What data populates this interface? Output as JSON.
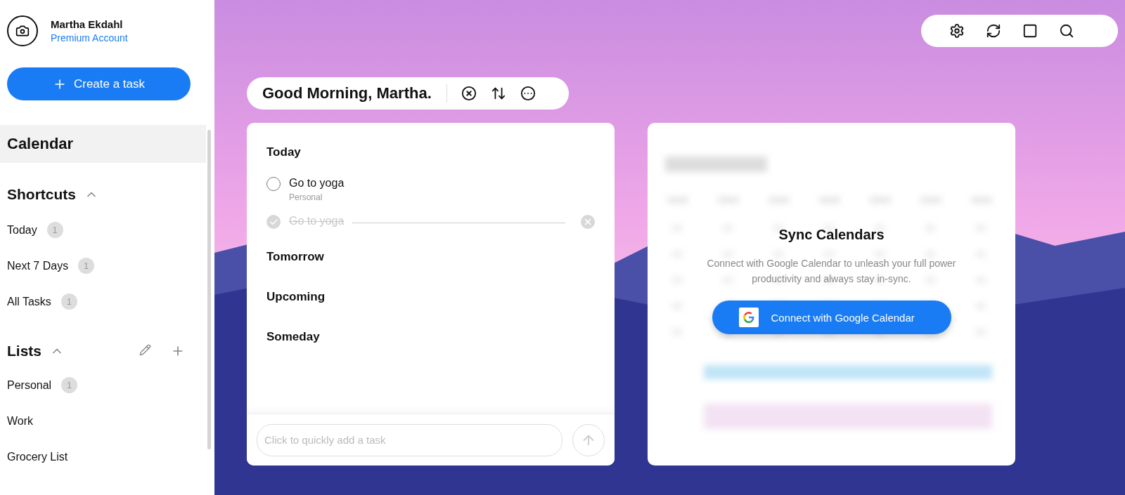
{
  "sidebar": {
    "user": {
      "name": "Martha Ekdahl",
      "plan": "Premium Account"
    },
    "create_button": "Create a task",
    "calendar_item": {
      "label": "Calendar",
      "selected": true
    },
    "sections": [
      {
        "kind": "shortcuts",
        "title": "Shortcuts",
        "expanded": true,
        "items": [
          {
            "label": "Today",
            "count": "1"
          },
          {
            "label": "Next 7 Days",
            "count": "1"
          },
          {
            "label": "All Tasks",
            "count": "1"
          }
        ]
      },
      {
        "kind": "lists",
        "title": "Lists",
        "expanded": true,
        "items": [
          {
            "label": "Personal",
            "count": "1"
          },
          {
            "label": "Work"
          },
          {
            "label": "Grocery List"
          }
        ]
      }
    ]
  },
  "greeting": "Good Morning, Martha.",
  "task_groups": [
    {
      "title": "Today",
      "tasks": [
        {
          "title": "Go to yoga",
          "list": "Personal",
          "done": false
        },
        {
          "title": "Go to yoga",
          "done": true
        }
      ]
    },
    {
      "title": "Tomorrow"
    },
    {
      "title": "Upcoming"
    },
    {
      "title": "Someday"
    }
  ],
  "quick_add": {
    "placeholder": "Click to quickly add a task"
  },
  "sync": {
    "title": "Sync Calendars",
    "text": "Connect with Google Calendar to unleash your full power productivity and always stay in-sync.",
    "button": "Connect with Google Calendar"
  }
}
